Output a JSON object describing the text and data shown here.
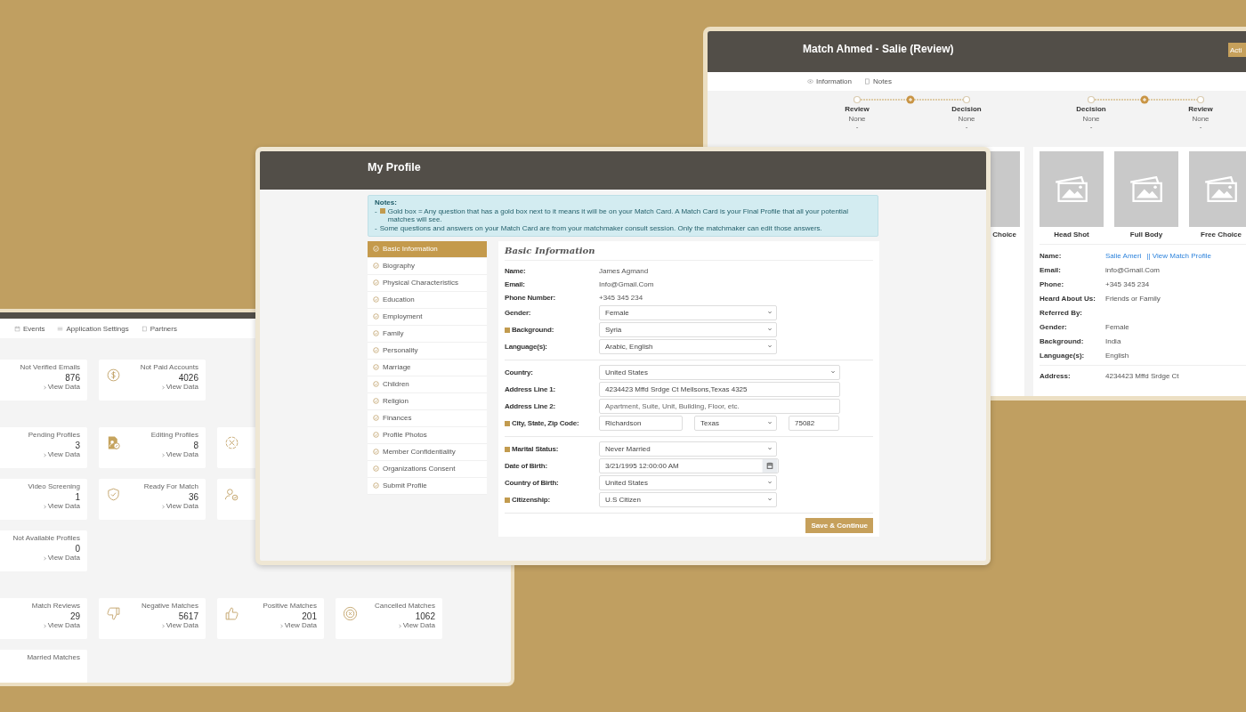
{
  "match_window": {
    "title": "Match Ahmed - Salie (Review)",
    "action_button": "Acti",
    "tabs": [
      {
        "label": "Information",
        "kind": "eye",
        "selected": false
      },
      {
        "label": "Notes",
        "kind": "note",
        "selected": false
      }
    ],
    "timelines": [
      {
        "steps": [
          {
            "label": "Review",
            "status": "None",
            "detail": "-"
          },
          {
            "label": "Decision",
            "status": "None",
            "detail": "-"
          }
        ]
      },
      {
        "steps": [
          {
            "label": "Decision",
            "status": "None",
            "detail": "-"
          },
          {
            "label": "Review",
            "status": "None",
            "detail": "-"
          }
        ]
      }
    ],
    "left_photos": [
      {
        "label": "Choice"
      }
    ],
    "right_photos": [
      {
        "label": "Head Shot"
      },
      {
        "label": "Full Body"
      },
      {
        "label": "Free Choice"
      }
    ],
    "details": [
      {
        "label": "Name:",
        "value": "Salie Ameri",
        "link": "|| View Match Profile"
      },
      {
        "label": "Email:",
        "value": "info@Gmail.Com"
      },
      {
        "label": "Phone:",
        "value": "+345 345 234"
      },
      {
        "label": "Heard About Us:",
        "value": "Friends or Family"
      },
      {
        "label": "Referred By:"
      },
      {
        "label": "Gender:",
        "value": "Female"
      },
      {
        "label": "Background:",
        "value": "India"
      },
      {
        "label": "Language(s):",
        "value": "English"
      }
    ],
    "address": {
      "label": "Address:",
      "value": "4234423 Mffd Srdge Ct"
    }
  },
  "dashboard": {
    "nav": [
      {
        "label": "Events",
        "kind": "calendar"
      },
      {
        "label": "Application Settings",
        "kind": "sliders"
      },
      {
        "label": "Partners",
        "kind": "document"
      }
    ],
    "sections": [
      {
        "rows": [
          [
            {
              "label": "Not Verified Emails",
              "value": "876",
              "link": "View Data"
            },
            {
              "kind": "dollar",
              "label": "Not Paid Accounts",
              "value": "4026",
              "link": "View Data"
            }
          ]
        ]
      },
      {
        "rows": [
          [
            {
              "label": "Pending Profiles",
              "value": "3",
              "link": "View Data"
            },
            {
              "kind": "edit-profile",
              "label": "Editing Profiles",
              "value": "8",
              "link": "View Data"
            },
            {
              "kind": "x-circle"
            }
          ],
          [
            {
              "label": "Video Screening",
              "value": "1",
              "link": "View Data"
            },
            {
              "kind": "shield",
              "label": "Ready For Match",
              "value": "36",
              "link": "View Data"
            },
            {
              "kind": "person-check"
            }
          ],
          [
            {
              "label": "Not Available Profiles",
              "value": "0",
              "link": "View Data"
            }
          ]
        ]
      },
      {
        "rows": [
          [
            {
              "label": "Match Reviews",
              "value": "29",
              "link": "View Data"
            },
            {
              "kind": "thumbs-down",
              "label": "Negative Matches",
              "value": "5617",
              "link": "View Data"
            },
            {
              "kind": "thumbs-up",
              "label": "Positive Matches",
              "value": "201",
              "link": "View Data"
            },
            {
              "kind": "cancel",
              "label": "Cancelled Matches",
              "value": "1062",
              "link": "View Data"
            }
          ],
          [
            {
              "label": "Married Matches"
            }
          ]
        ]
      }
    ]
  },
  "profile_window": {
    "title": "My Profile",
    "notes": {
      "title": "Notes:",
      "lines": [
        {
          "bullet": "-",
          "gold_box": true,
          "text": "Gold box = Any question that has a gold box next to it means it will be on your Match Card. A Match Card is your Final Profile that all your potential matches will see."
        },
        {
          "bullet": "-",
          "gold_box": false,
          "text": "Some questions and answers on your Match Card are from your matchmaker consult session. Only the matchmaker can edit those answers."
        }
      ]
    },
    "menu": [
      {
        "label": "Basic Information",
        "selected": true
      },
      {
        "label": "Biography",
        "selected": false
      },
      {
        "label": "Physical Characteristics",
        "selected": false
      },
      {
        "label": "Education",
        "selected": false
      },
      {
        "label": "Employment",
        "selected": false
      },
      {
        "label": "Family",
        "selected": false
      },
      {
        "label": "Personality",
        "selected": false
      },
      {
        "label": "Marriage",
        "selected": false
      },
      {
        "label": "Children",
        "selected": false
      },
      {
        "label": "Religion",
        "selected": false
      },
      {
        "label": "Finances",
        "selected": false
      },
      {
        "label": "Profile Photos",
        "selected": false
      },
      {
        "label": "Member Confidentiality",
        "selected": false
      },
      {
        "label": "Organizations Consent",
        "selected": false
      },
      {
        "label": "Submit Profile",
        "selected": false
      }
    ],
    "form": {
      "title": "Basic Information",
      "sections": [
        {
          "rows": [
            {
              "label": "Name:",
              "gold_box": false,
              "kind": "text",
              "value": "James Agmand"
            },
            {
              "label": "Email:",
              "gold_box": false,
              "kind": "text",
              "value": "Info@Gmail.Com"
            },
            {
              "label": "Phone Number:",
              "gold_box": false,
              "kind": "text",
              "value": "+345 345 234"
            },
            {
              "label": "Gender:",
              "gold_box": false,
              "kind": "select",
              "value": "Female"
            },
            {
              "label": "Background:",
              "gold_box": true,
              "kind": "select",
              "value": "Syria"
            },
            {
              "label": "Language(s):",
              "gold_box": false,
              "kind": "select",
              "value": "Arabic, English"
            }
          ]
        },
        {
          "rows": [
            {
              "label": "Country:",
              "gold_box": false,
              "kind": "wideselect",
              "value": "United States"
            },
            {
              "label": "Address Line 1:",
              "gold_box": false,
              "kind": "input",
              "value": "4234423 Mffd Srdge Ct Mellsons,Texas 4325"
            },
            {
              "label": "Address Line 2:",
              "gold_box": false,
              "kind": "input",
              "placeholder": "Apartment, Suite, Unit, Building, Floor, etc."
            },
            {
              "label": "City, State, Zip Code:",
              "gold_box": true,
              "kind": "group",
              "fields": [
                {
                  "kind": "input",
                  "value": "Richardson"
                },
                {
                  "kind": "select",
                  "value": "Texas"
                },
                {
                  "kind": "input",
                  "value": "75082"
                }
              ]
            }
          ]
        },
        {
          "rows": [
            {
              "label": "Marital Status:",
              "gold_box": true,
              "kind": "select",
              "value": "Never Married"
            },
            {
              "label": "Date of Birth:",
              "gold_box": false,
              "kind": "date",
              "value": "3/21/1995 12:00:00 AM"
            },
            {
              "label": "Country of Birth:",
              "gold_box": false,
              "kind": "select",
              "value": "United States"
            },
            {
              "label": "Citizenship:",
              "gold_box": true,
              "kind": "select",
              "value": "U.S Citizen"
            }
          ]
        }
      ],
      "submit": "Save & Continue"
    }
  }
}
